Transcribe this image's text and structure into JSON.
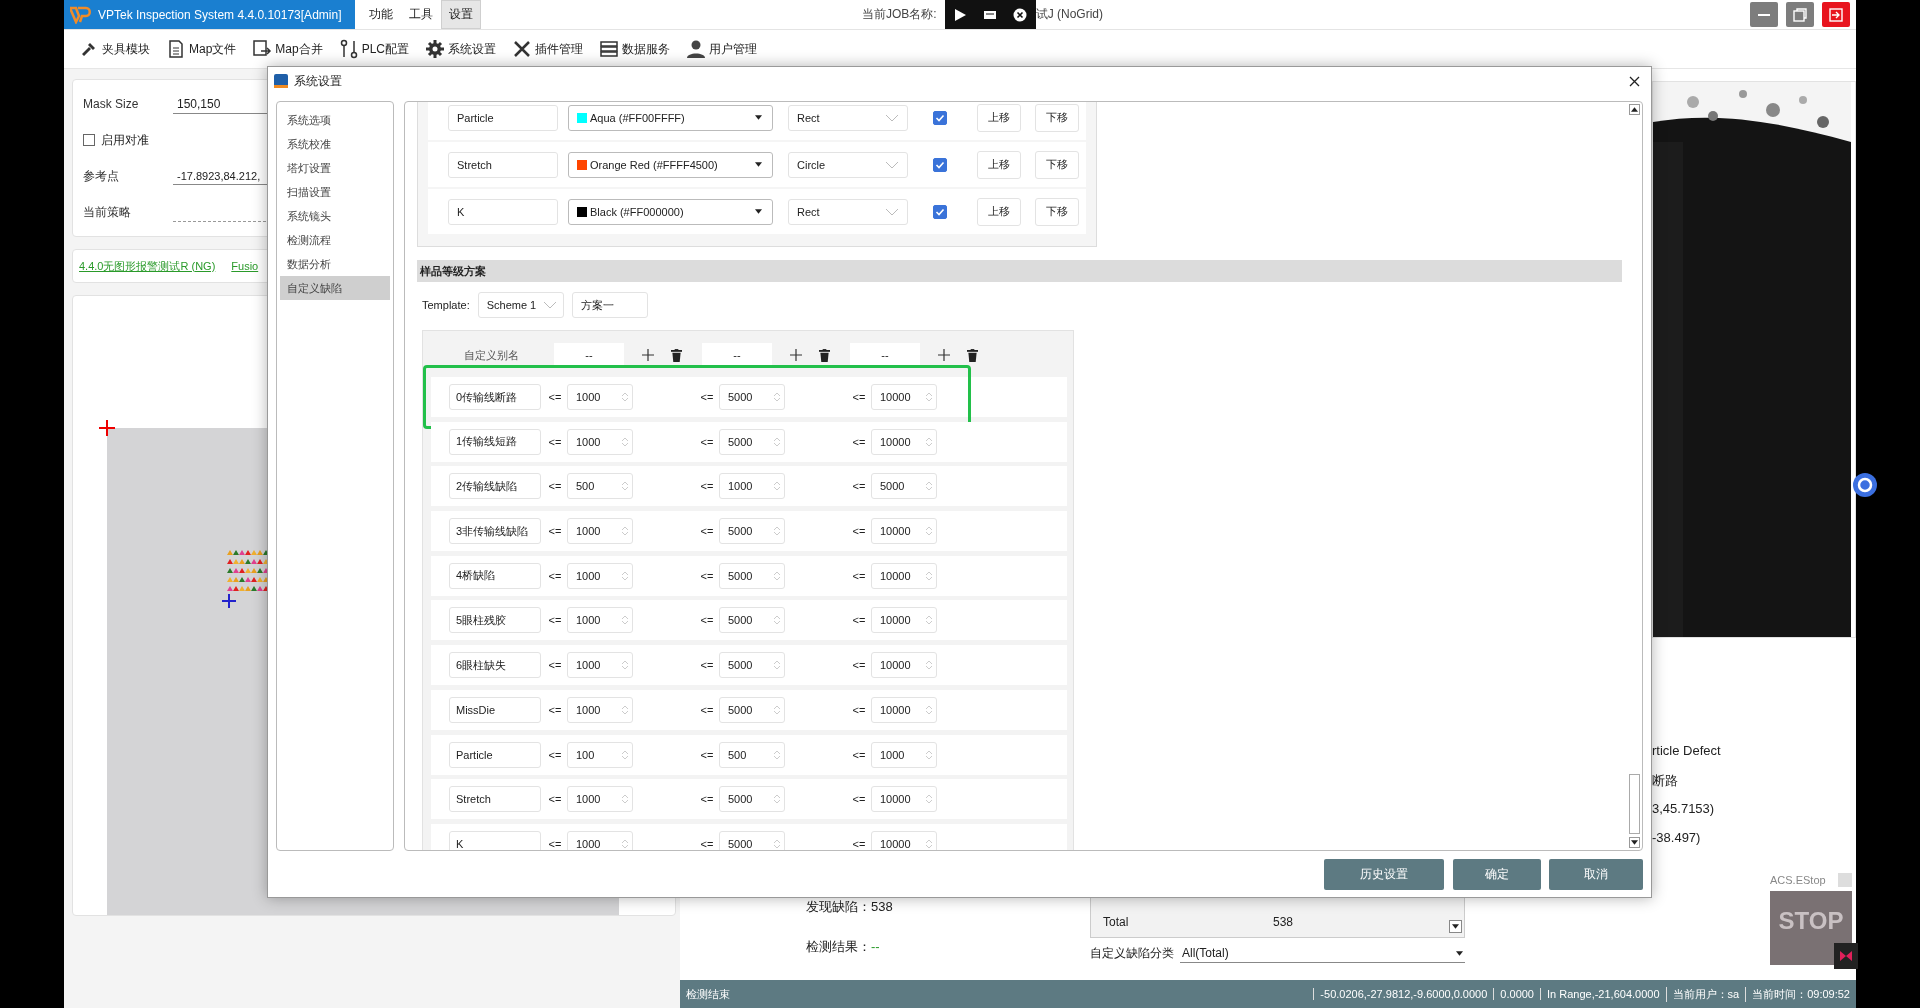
{
  "title_bar": {
    "app_title": "VPTek Inspection System 4.4.0.10173[Admin]",
    "menu": [
      {
        "label": "功能",
        "selected": false
      },
      {
        "label": "工具",
        "selected": false
      },
      {
        "label": "设置",
        "selected": true
      }
    ],
    "job_label": "当前JOB名称:",
    "job_name": "试J (NoGrid)"
  },
  "toolbar": [
    {
      "label": "夹具模块",
      "kind": "clamp"
    },
    {
      "label": "Map文件",
      "kind": "file"
    },
    {
      "label": "Map合并",
      "kind": "merge"
    },
    {
      "label": "PLC配置",
      "kind": "plc"
    },
    {
      "label": "系统设置",
      "kind": "gear"
    },
    {
      "label": "插件管理",
      "kind": "tools"
    },
    {
      "label": "数据服务",
      "kind": "server"
    },
    {
      "label": "用户管理",
      "kind": "user"
    }
  ],
  "left_panel": {
    "mask_size_label": "Mask Size",
    "mask_size": "150,150",
    "align_label": "启用对准",
    "align_checked": false,
    "ref_label": "参考点",
    "ref_value": "-17.8923,84.212,",
    "strategy_label": "当前策略",
    "links": [
      "4.4.0无图形报警测试R (NG)",
      "Fusio"
    ]
  },
  "dialog": {
    "title": "系统设置",
    "nav": [
      {
        "label": "系统选项",
        "selected": false
      },
      {
        "label": "系统校准",
        "selected": false
      },
      {
        "label": "塔灯设置",
        "selected": false
      },
      {
        "label": "扫描设置",
        "selected": false
      },
      {
        "label": "系统镜头",
        "selected": false
      },
      {
        "label": "检测流程",
        "selected": false
      },
      {
        "label": "数据分析",
        "selected": false
      },
      {
        "label": "自定义缺陷",
        "selected": true
      }
    ],
    "color_rows": [
      {
        "name": "Particle",
        "color_name": "Aqua (#FF00FFFF)",
        "color": "#00ffff",
        "shape": "Rect",
        "checked": true,
        "up": "上移",
        "down": "下移"
      },
      {
        "name": "Stretch",
        "color_name": "Orange Red (#FFFF4500)",
        "color": "#ff4500",
        "shape": "Circle",
        "checked": true,
        "up": "上移",
        "down": "下移"
      },
      {
        "name": "K",
        "color_name": "Black (#FF000000)",
        "color": "#000000",
        "shape": "Rect",
        "checked": true,
        "up": "上移",
        "down": "下移"
      }
    ],
    "section_title": "样品等级方案",
    "template_label": "Template:",
    "template": "Scheme 1",
    "scheme_name": "方案一",
    "grade_header": {
      "label": "自定义别名",
      "aliases": [
        "--",
        "--",
        "--"
      ]
    },
    "grade_rows": [
      {
        "name": "0传输线断路",
        "highlighted": true,
        "cells": [
          {
            "op": "<=",
            "value": "1000"
          },
          {
            "op": "<=",
            "value": "5000"
          },
          {
            "op": "<=",
            "value": "10000"
          }
        ]
      },
      {
        "name": "1传输线短路",
        "highlighted": false,
        "cells": [
          {
            "op": "<=",
            "value": "1000"
          },
          {
            "op": "<=",
            "value": "5000"
          },
          {
            "op": "<=",
            "value": "10000"
          }
        ]
      },
      {
        "name": "2传输线缺陷",
        "highlighted": false,
        "cells": [
          {
            "op": "<=",
            "value": "500"
          },
          {
            "op": "<=",
            "value": "1000"
          },
          {
            "op": "<=",
            "value": "5000"
          }
        ]
      },
      {
        "name": "3非传输线缺陷",
        "highlighted": false,
        "cells": [
          {
            "op": "<=",
            "value": "1000"
          },
          {
            "op": "<=",
            "value": "5000"
          },
          {
            "op": "<=",
            "value": "10000"
          }
        ]
      },
      {
        "name": "4桥缺陷",
        "highlighted": false,
        "cells": [
          {
            "op": "<=",
            "value": "1000"
          },
          {
            "op": "<=",
            "value": "5000"
          },
          {
            "op": "<=",
            "value": "10000"
          }
        ]
      },
      {
        "name": "5眼柱残胶",
        "highlighted": false,
        "cells": [
          {
            "op": "<=",
            "value": "1000"
          },
          {
            "op": "<=",
            "value": "5000"
          },
          {
            "op": "<=",
            "value": "10000"
          }
        ]
      },
      {
        "name": "6眼柱缺失",
        "highlighted": false,
        "cells": [
          {
            "op": "<=",
            "value": "1000"
          },
          {
            "op": "<=",
            "value": "5000"
          },
          {
            "op": "<=",
            "value": "10000"
          }
        ]
      },
      {
        "name": "MissDie",
        "highlighted": false,
        "cells": [
          {
            "op": "<=",
            "value": "1000"
          },
          {
            "op": "<=",
            "value": "5000"
          },
          {
            "op": "<=",
            "value": "10000"
          }
        ]
      },
      {
        "name": "Particle",
        "highlighted": false,
        "cells": [
          {
            "op": "<=",
            "value": "100"
          },
          {
            "op": "<=",
            "value": "500"
          },
          {
            "op": "<=",
            "value": "1000"
          }
        ]
      },
      {
        "name": "Stretch",
        "highlighted": false,
        "cells": [
          {
            "op": "<=",
            "value": "1000"
          },
          {
            "op": "<=",
            "value": "5000"
          },
          {
            "op": "<=",
            "value": "10000"
          }
        ]
      },
      {
        "name": "K",
        "highlighted": false,
        "cells": [
          {
            "op": "<=",
            "value": "1000"
          },
          {
            "op": "<=",
            "value": "5000"
          },
          {
            "op": "<=",
            "value": "10000"
          }
        ]
      }
    ],
    "buttons": [
      "历史设置",
      "确定",
      "取消"
    ]
  },
  "results": {
    "found_label": "发现缺陷：",
    "found": "538",
    "result_label": "检测结果：",
    "result": "--",
    "table_rows": [
      {
        "column_1": "Total",
        "column_2": "538"
      }
    ],
    "category_label": "自定义缺陷分类",
    "category": "All(Total)"
  },
  "right_panel": {
    "lines": [
      "rticle Defect",
      "断路",
      "3,45.7153)",
      "-38.497)"
    ],
    "estop_title": "ACS.EStop",
    "estop_sign": "STOP"
  },
  "status_bar": {
    "message": "检测结束",
    "fields": [
      "-50.0206,-27.9812,-9.6000,0.0000",
      "0.0000",
      "In Range,-21,604.0000",
      "当前用户：sa",
      "当前时间：09:09:52"
    ]
  }
}
